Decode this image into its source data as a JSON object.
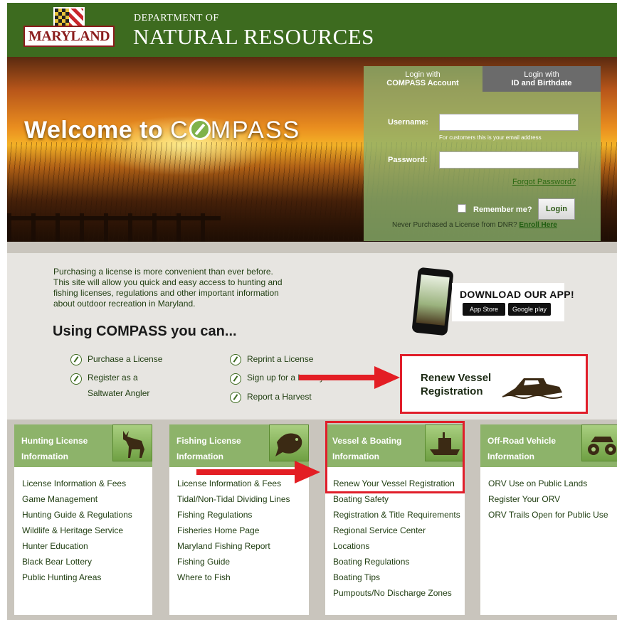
{
  "header": {
    "logo_text": "MARYLAND",
    "dept_small": "DEPARTMENT OF",
    "dept_big": "NATURAL RESOURCES"
  },
  "hero": {
    "welcome": "Welcome to",
    "compass_pre": "C",
    "compass_post": "MPASS"
  },
  "login": {
    "tab_compass_l1": "Login with",
    "tab_compass_l2": "COMPASS Account",
    "tab_id_l1": "Login with",
    "tab_id_l2": "ID and Birthdate",
    "username_label": "Username:",
    "username_hint": "For customers this is your email address",
    "password_label": "Password:",
    "forgot": "Forgot Password?",
    "remember": "Remember me?",
    "login_button": "Login",
    "never_purchased": "Never Purchased a License from DNR?",
    "enroll": "Enroll Here"
  },
  "intro": {
    "text": "Purchasing a license is more convenient than ever before. This site will allow you quick and easy access to hunting and fishing licenses, regulations and other important information about outdoor recreation in Maryland.",
    "using_heading": "Using COMPASS you can..."
  },
  "options": {
    "purchase": "Purchase a License",
    "register_l1": "Register as a",
    "register_l2": "Saltwater Angler",
    "reprint": "Reprint a License",
    "signup": "Sign up for a Lottery",
    "report": "Report a Harvest"
  },
  "app": {
    "title": "DOWNLOAD OUR APP!",
    "appstore": "App Store",
    "googleplay": "Google play"
  },
  "renew": {
    "line1": "Renew Vessel",
    "line2": "Registration"
  },
  "cards": {
    "hunting": {
      "title": "Hunting License Information",
      "items": [
        "License Information & Fees",
        "Game Management",
        "Hunting Guide & Regulations",
        "Wildlife & Heritage Service",
        "Hunter Education",
        "Black Bear Lottery",
        "Public Hunting Areas"
      ]
    },
    "fishing": {
      "title": "Fishing License Information",
      "items": [
        "License Information & Fees",
        "Tidal/Non-Tidal Dividing Lines",
        "Fishing Regulations",
        "Fisheries Home Page",
        "Maryland Fishing Report",
        "Fishing Guide",
        "Where to Fish"
      ]
    },
    "vessel": {
      "title": "Vessel & Boating Information",
      "items": [
        "Renew Your Vessel Registration",
        "Boating Safety",
        "Registration & Title Requirements",
        "Regional Service Center",
        "Locations",
        "Boating Regulations",
        "Boating Tips",
        "Pumpouts/No Discharge Zones"
      ]
    },
    "orv": {
      "title": "Off-Road Vehicle Information",
      "items": [
        "ORV Use on Public Lands",
        "Register Your ORV",
        "ORV Trails Open for Public Use"
      ]
    }
  },
  "colors": {
    "header_green": "#3d6b1f",
    "card_green": "#8db36a",
    "highlight_red": "#e01e2a"
  }
}
